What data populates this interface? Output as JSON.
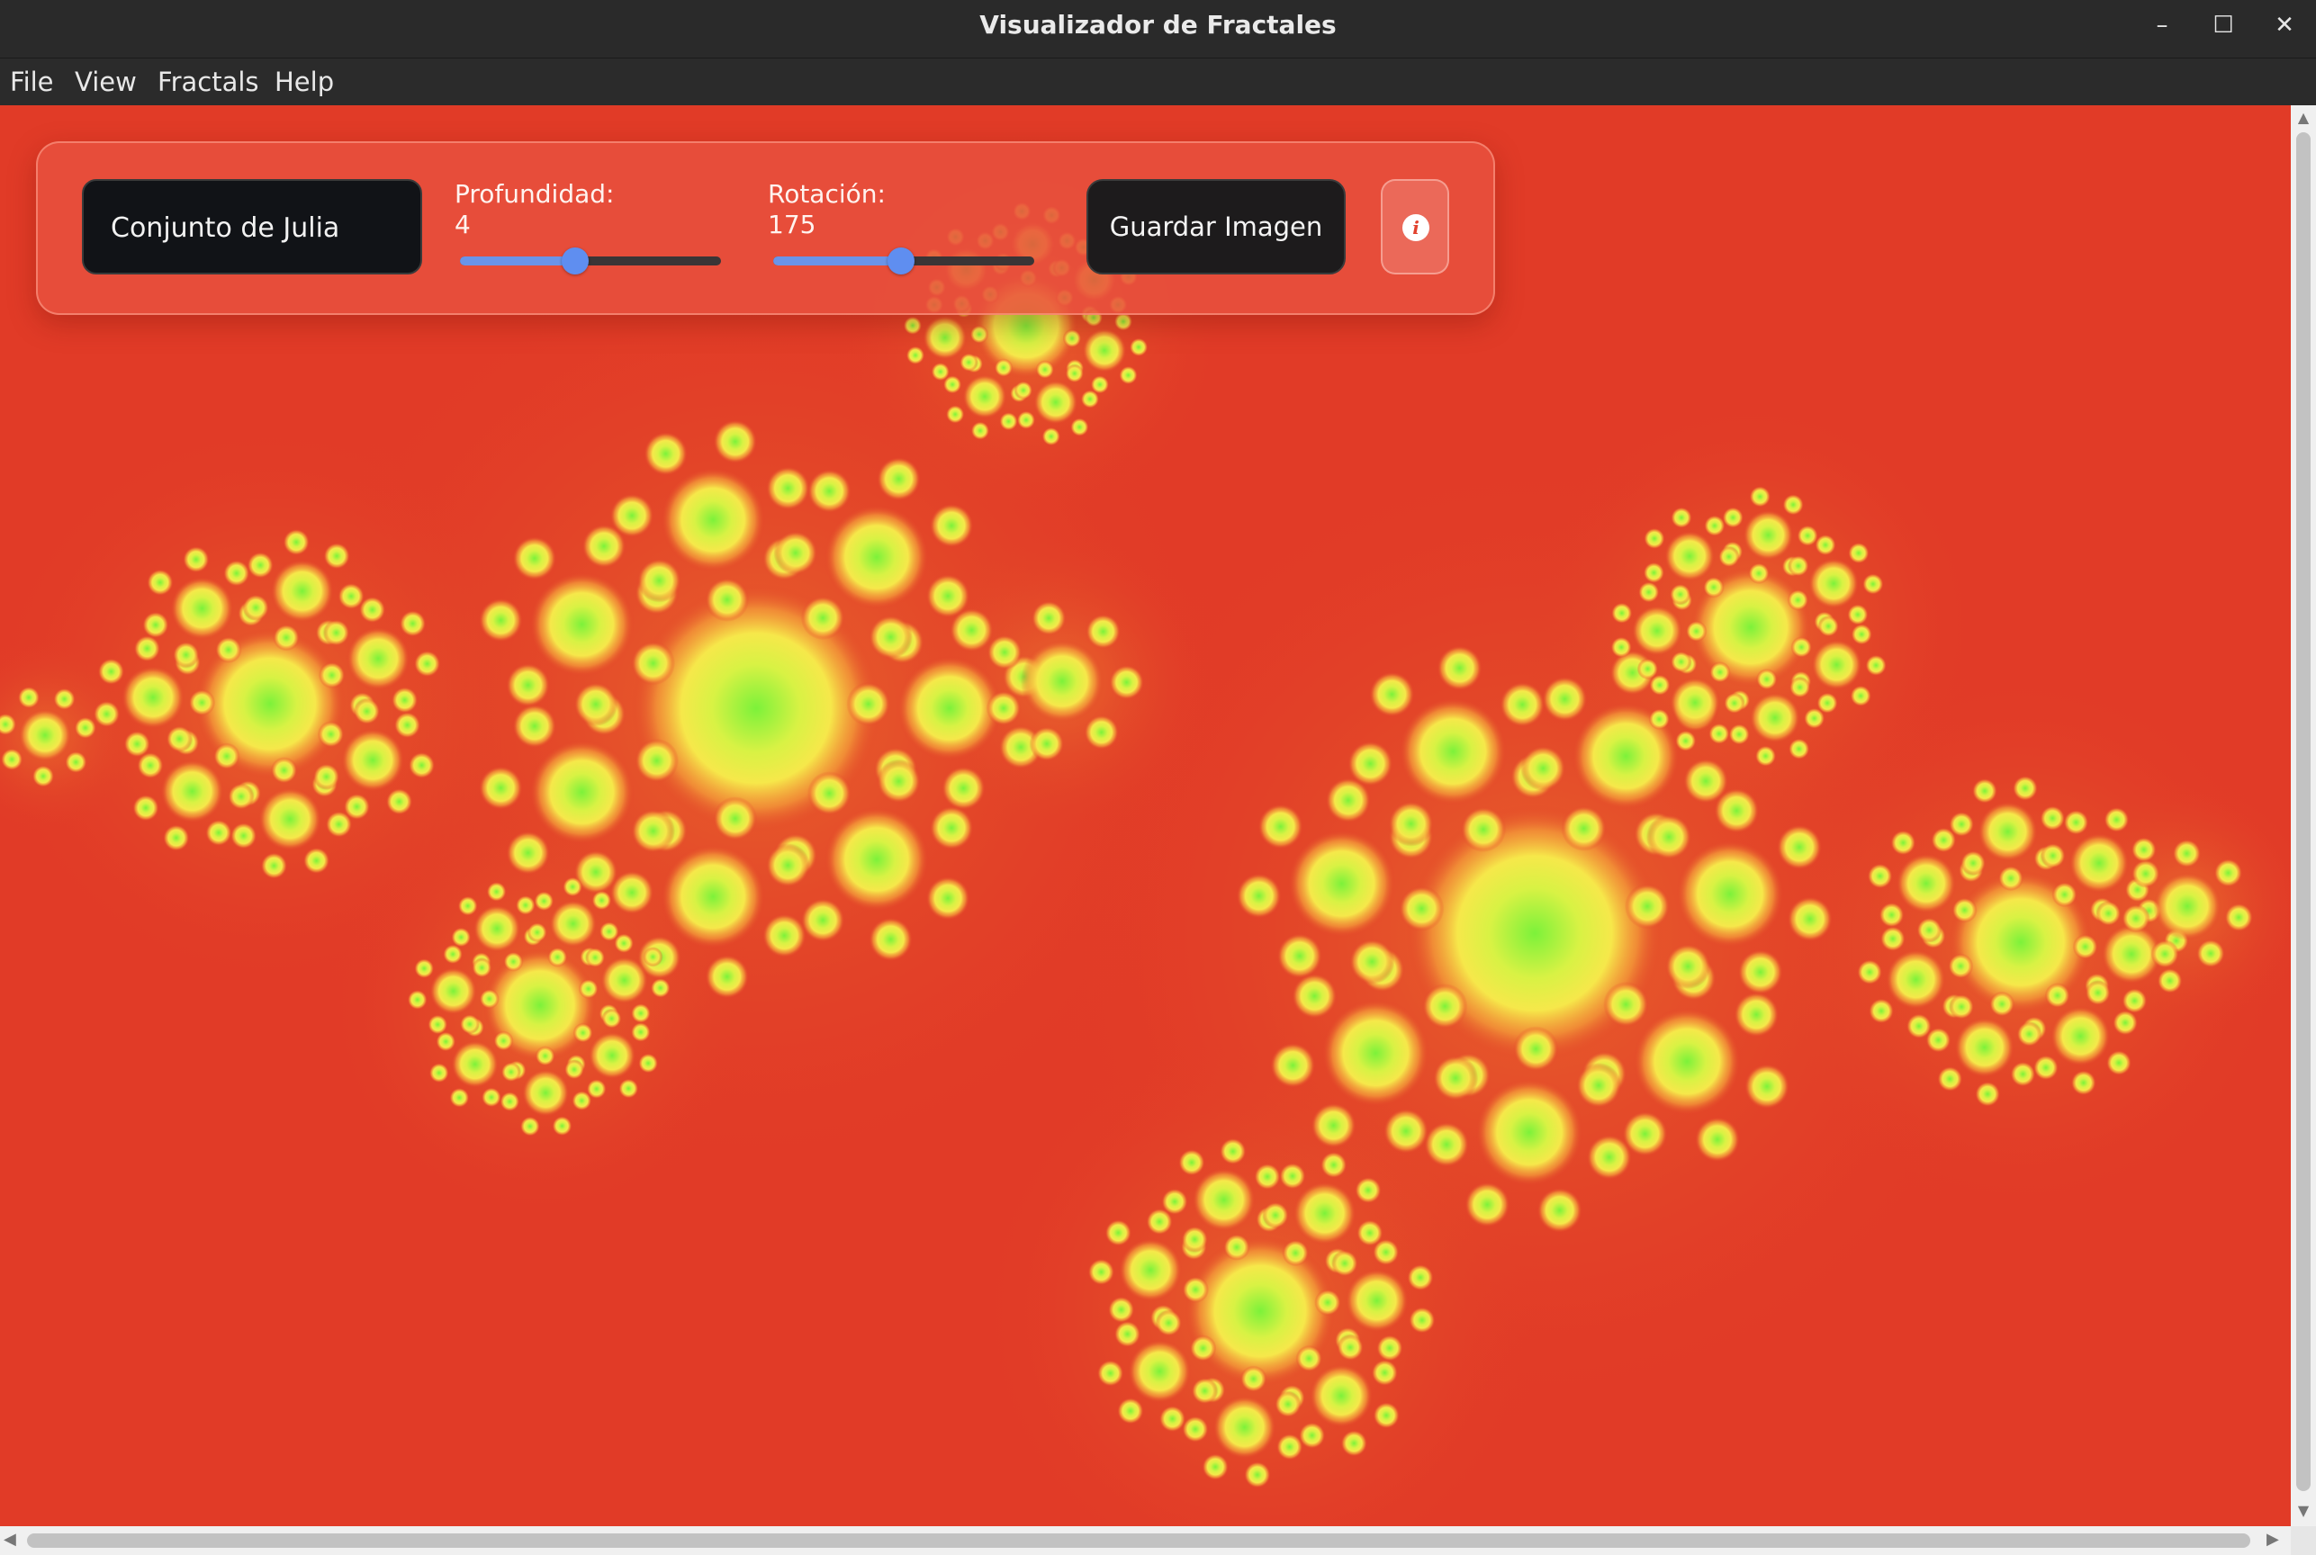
{
  "window": {
    "title": "Visualizador de Fractales",
    "minimize_icon": "minimize-icon",
    "maximize_icon": "maximize-icon",
    "close_icon": "close-icon",
    "minimize_glyph": "–",
    "maximize_glyph": "☐",
    "close_glyph": "✕"
  },
  "menu": {
    "items": [
      {
        "label": "File"
      },
      {
        "label": "View"
      },
      {
        "label": "Fractals"
      },
      {
        "label": "Help"
      }
    ]
  },
  "controls": {
    "fractal_type": "Conjunto de Julia",
    "depth": {
      "label": "Profundidad:",
      "value": "4",
      "level": 0.44
    },
    "rotation": {
      "label": "Rotación:",
      "value": "175",
      "level": 0.49
    },
    "save_label": "Guardar Imagen",
    "info_icon": "info-icon",
    "info_glyph": "i"
  },
  "colors": {
    "background_red": "#e13b27",
    "fractal_yellow": "#f8ee4f",
    "fractal_green": "#6cf03a",
    "slider_accent": "#5f8ef0"
  },
  "scrollbars": {
    "up": "▲",
    "down": "▼",
    "left": "◀",
    "right": "▶"
  }
}
